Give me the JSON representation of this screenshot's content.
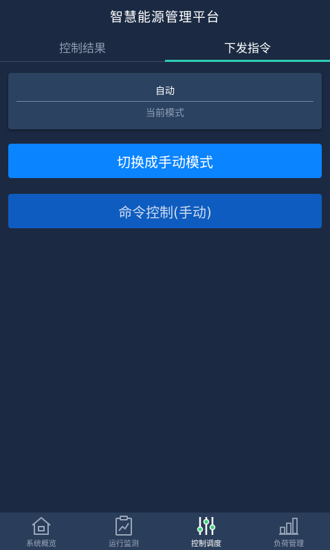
{
  "header": {
    "title": "智慧能源管理平台"
  },
  "tabs": [
    {
      "label": "控制结果",
      "active": false
    },
    {
      "label": "下发指令",
      "active": true
    }
  ],
  "mode_card": {
    "value": "自动",
    "caption": "当前模式"
  },
  "buttons": {
    "switch_mode": "切换成手动模式",
    "command_control": "命令控制(手动)"
  },
  "bottom_nav": [
    {
      "label": "系统概览",
      "icon": "home-icon",
      "active": false
    },
    {
      "label": "运行监测",
      "icon": "monitor-clipboard-icon",
      "active": false
    },
    {
      "label": "控制调度",
      "icon": "sliders-icon",
      "active": true
    },
    {
      "label": "负荷管理",
      "icon": "bar-chart-icon",
      "active": false
    }
  ],
  "colors": {
    "background": "#1b2a42",
    "tab_indicator": "#2fd0b4",
    "primary_button": "#0a84ff",
    "secondary_button": "#0e5cc0",
    "nav_background": "#2a3d5a",
    "active_icon_accent": "#3fd17a"
  }
}
